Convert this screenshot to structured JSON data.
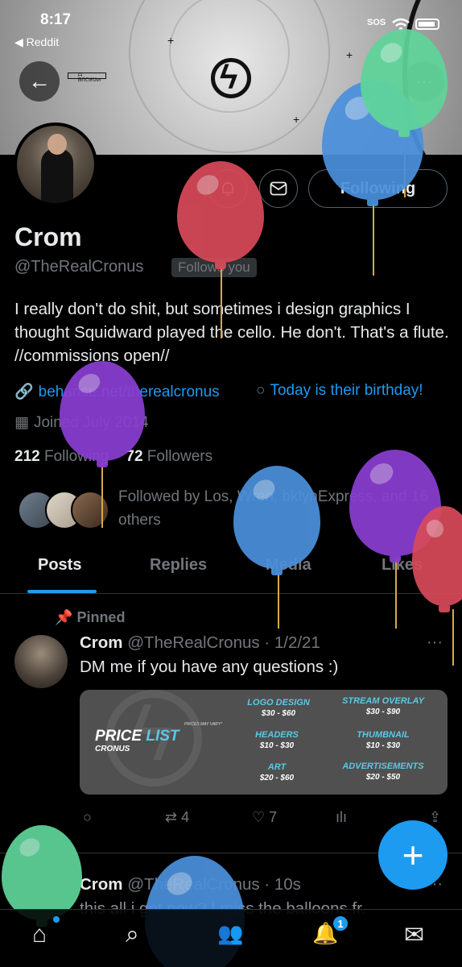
{
  "status_bar": {
    "time": "8:17",
    "back_app": "◀ Reddit",
    "sos": "SOS"
  },
  "header": {
    "back_icon": "←",
    "more_icon": "···",
    "banner_tag": "ᗩ ᗷᑎᑕIᖇᑌᔕ"
  },
  "profile": {
    "name": "Crom",
    "handle": "@TheRealCronus",
    "follows_you": "Follows you",
    "following_label": "Following",
    "bio": "I really don't do shit, but sometimes i design graphics I thought Squidward played the cello. He don't. That's a flute. //commissions open//",
    "link_icon": "🔗",
    "link": "behance.net/therealcronus",
    "birthday_icon": "○",
    "birthday": "Today is their birthday!",
    "joined_icon": "▦",
    "joined": "Joined July 2014",
    "following_count": "212",
    "following_text": "Following",
    "followers_count": "72",
    "followers_text": "Followers",
    "followed_by": "Followed by Los, Wren, bklynExpress, and 16 others"
  },
  "tabs": [
    {
      "label": "Posts"
    },
    {
      "label": "Replies"
    },
    {
      "label": "Media"
    },
    {
      "label": "Likes"
    }
  ],
  "pinned_post": {
    "pinned_label": "Pinned",
    "author": "Crom",
    "handle_date": "@TheRealCronus · 1/2/21",
    "text": "DM me if you have any questions :)",
    "more": "···",
    "price_card": {
      "title_a": "PRICE ",
      "title_b": "LIST",
      "subtitle": "CRONUS",
      "note": "PRICES MAY VARY*",
      "services": [
        {
          "title": "LOGO DESIGN",
          "price": "$30 - $60"
        },
        {
          "title": "STREAM OVERLAY",
          "price": "$30 - $90"
        },
        {
          "title": "HEADERS",
          "price": "$10 - $30"
        },
        {
          "title": "THUMBNAIL",
          "price": "$10 - $30"
        },
        {
          "title": "ART",
          "price": "$20 - $60"
        },
        {
          "title": "ADVERTISEMENTS",
          "price": "$20 - $50"
        }
      ]
    },
    "actions": {
      "reply_icon": "○",
      "retweet_icon": "⇄",
      "retweets": "4",
      "like_icon": "♡",
      "likes": "7",
      "views_icon": "ılı",
      "share_icon": "⇪"
    }
  },
  "second_post": {
    "author": "Crom",
    "handle_date": "@TheRealCronus · 10s",
    "text": "this all i get now? I miss the balloons fr.",
    "more": "···"
  },
  "fab_label": "+",
  "bottom_nav": {
    "home_icon": "⌂",
    "search_icon": "⌕",
    "communities_icon": "👥",
    "notifications_icon": "🔔",
    "notifications_badge": "1",
    "messages_icon": "✉"
  }
}
